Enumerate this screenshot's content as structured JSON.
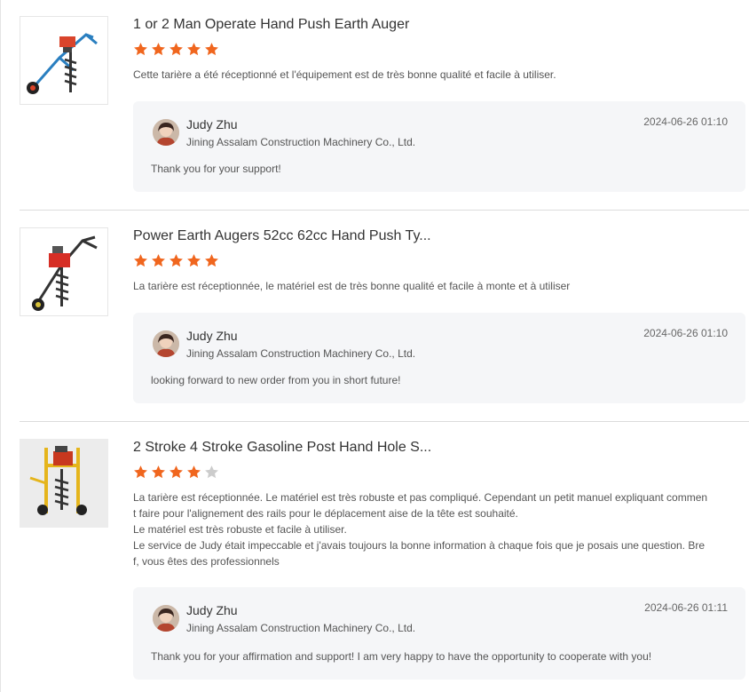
{
  "colors": {
    "star_active": "#f0661e",
    "star_inactive": "#cccccc",
    "reply_bg": "#f5f6f8"
  },
  "reviews": [
    {
      "title": "1 or 2 Man Operate Hand Push Earth Auger",
      "rating": 5,
      "rating_max": 5,
      "comment": [
        "Cette tarière a été réceptionné et l'équipement est de très bonne qualité et facile à utiliser."
      ],
      "reply": {
        "name": "Judy Zhu",
        "company": "Jining Assalam Construction Machinery Co., Ltd.",
        "time": "2024-06-26 01:10",
        "text": "Thank you for your support!"
      }
    },
    {
      "title": "Power Earth Augers 52cc 62cc Hand Push Ty...",
      "rating": 5,
      "rating_max": 5,
      "comment": [
        "La tarière est réceptionnée, le matériel est de très bonne qualité et facile à monte et à utiliser"
      ],
      "reply": {
        "name": "Judy Zhu",
        "company": "Jining Assalam Construction Machinery Co., Ltd.",
        "time": "2024-06-26 01:10",
        "text": "looking forward to new order from you in short future!"
      }
    },
    {
      "title": "2 Stroke 4 Stroke Gasoline Post Hand Hole S...",
      "rating": 4,
      "rating_max": 5,
      "comment": [
        "La tarière est réceptionnée. Le matériel est très robuste et pas compliqué. Cependant un petit manuel expliquant commen",
        "t faire pour l'alignement des rails pour le déplacement aise de la tête est souhaité.",
        "Le matériel est très robuste et facile à utiliser.",
        "Le service de Judy était impeccable et j'avais toujours la bonne information à chaque fois que je posais une question. Bre",
        "f, vous êtes des professionnels"
      ],
      "reply": {
        "name": "Judy Zhu",
        "company": "Jining Assalam Construction Machinery Co., Ltd.",
        "time": "2024-06-26 01:11",
        "text": "Thank you for your affirmation and support! I am very happy to have the opportunity to cooperate with you!"
      }
    }
  ]
}
